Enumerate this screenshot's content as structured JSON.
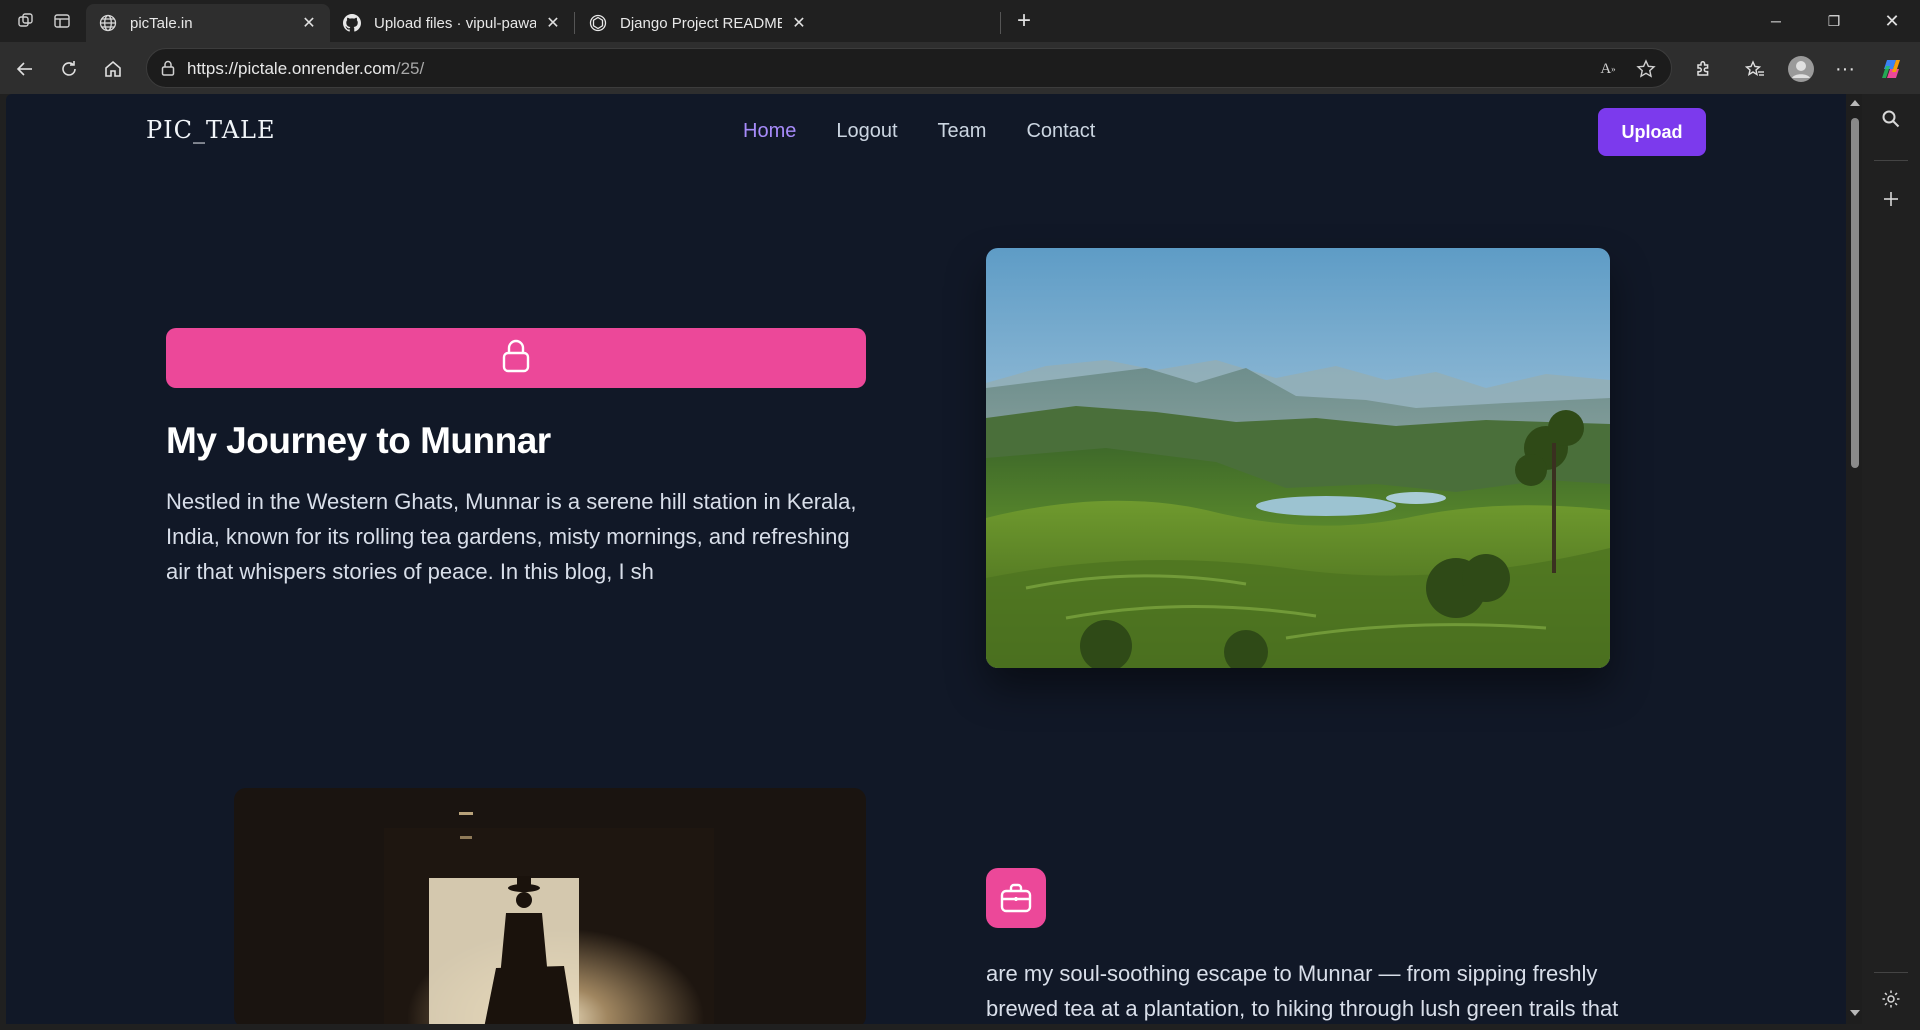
{
  "browser": {
    "tabs": [
      {
        "title": "picTale.in",
        "active": true,
        "icon": "globe-icon"
      },
      {
        "title": "Upload files · vipul-pawar/picTale",
        "active": false,
        "icon": "github-icon"
      },
      {
        "title": "Django Project README Creation",
        "active": false,
        "icon": "chatgpt-icon"
      }
    ],
    "url_host": "https://pictale.onrender.com",
    "url_path": "/25/"
  },
  "site": {
    "logo": "PIC_TALE",
    "nav": [
      {
        "label": "Home",
        "active": true
      },
      {
        "label": "Logout",
        "active": false
      },
      {
        "label": "Team",
        "active": false
      },
      {
        "label": "Contact",
        "active": false
      }
    ],
    "upload_label": "Upload",
    "accent": "#7c3aed",
    "pink": "#ec4899"
  },
  "post": {
    "title": "My Journey to Munnar",
    "excerpt": "Nestled in the Western Ghats, Munnar is a serene hill station in Kerala, India, known for its rolling tea gardens, misty mornings, and refreshing air that whispers stories of peace. In this blog, I sh",
    "continuation": "are my soul-soothing escape to Munnar — from sipping freshly brewed tea at a plantation, to hiking through lush green trails that"
  }
}
